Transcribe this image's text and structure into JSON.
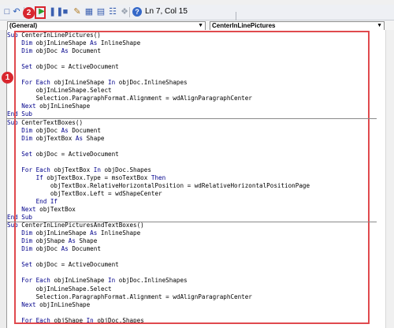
{
  "toolbar": {
    "status": "Ln 7, Col 15",
    "badge_run": "2"
  },
  "combos": {
    "object": "(General)",
    "procedure": "CenterInLinePictures"
  },
  "annotation": {
    "badge_code": "1"
  },
  "code_lines": [
    [
      {
        "t": "Sub ",
        "k": 1
      },
      {
        "t": "CenterInLinePictures()"
      }
    ],
    [
      {
        "t": "    "
      },
      {
        "t": "Dim ",
        "k": 1
      },
      {
        "t": "objInLineShape "
      },
      {
        "t": "As ",
        "k": 1
      },
      {
        "t": "InlineShape"
      }
    ],
    [
      {
        "t": "    "
      },
      {
        "t": "Dim ",
        "k": 1
      },
      {
        "t": "objDoc "
      },
      {
        "t": "As ",
        "k": 1
      },
      {
        "t": "Document"
      }
    ],
    [
      {
        "t": ""
      }
    ],
    [
      {
        "t": "    "
      },
      {
        "t": "Set ",
        "k": 1
      },
      {
        "t": "objDoc = ActiveDocument"
      }
    ],
    [
      {
        "t": ""
      }
    ],
    [
      {
        "t": "    "
      },
      {
        "t": "For Each ",
        "k": 1
      },
      {
        "t": "objInLineShape "
      },
      {
        "t": "In ",
        "k": 1
      },
      {
        "t": "objDoc.InlineShapes"
      }
    ],
    [
      {
        "t": "        objInLineShape.Select"
      }
    ],
    [
      {
        "t": "        Selection.ParagraphFormat.Alignment = wdAlignParagraphCenter"
      }
    ],
    [
      {
        "t": "    "
      },
      {
        "t": "Next ",
        "k": 1
      },
      {
        "t": "objInLineShape"
      }
    ],
    [
      {
        "t": "End Sub",
        "k": 1
      }
    ],
    [
      {
        "t": "Sub ",
        "k": 1
      },
      {
        "t": "CenterTextBoxes()"
      }
    ],
    [
      {
        "t": "    "
      },
      {
        "t": "Dim ",
        "k": 1
      },
      {
        "t": "objDoc "
      },
      {
        "t": "As ",
        "k": 1
      },
      {
        "t": "Document"
      }
    ],
    [
      {
        "t": "    "
      },
      {
        "t": "Dim ",
        "k": 1
      },
      {
        "t": "objTextBox "
      },
      {
        "t": "As ",
        "k": 1
      },
      {
        "t": "Shape"
      }
    ],
    [
      {
        "t": ""
      }
    ],
    [
      {
        "t": "    "
      },
      {
        "t": "Set ",
        "k": 1
      },
      {
        "t": "objDoc = ActiveDocument"
      }
    ],
    [
      {
        "t": ""
      }
    ],
    [
      {
        "t": "    "
      },
      {
        "t": "For Each ",
        "k": 1
      },
      {
        "t": "objTextBox "
      },
      {
        "t": "In ",
        "k": 1
      },
      {
        "t": "objDoc.Shapes"
      }
    ],
    [
      {
        "t": "        "
      },
      {
        "t": "If ",
        "k": 1
      },
      {
        "t": "objTextBox.Type = msoTextBox "
      },
      {
        "t": "Then",
        "k": 1
      }
    ],
    [
      {
        "t": "            objTextBox.RelativeHorizontalPosition = wdRelativeHorizontalPositionPage"
      }
    ],
    [
      {
        "t": "            objTextBox.Left = wdShapeCenter"
      }
    ],
    [
      {
        "t": "        "
      },
      {
        "t": "End If",
        "k": 1
      }
    ],
    [
      {
        "t": "    "
      },
      {
        "t": "Next ",
        "k": 1
      },
      {
        "t": "objTextBox"
      }
    ],
    [
      {
        "t": "End Sub",
        "k": 1
      }
    ],
    [
      {
        "t": "Sub ",
        "k": 1
      },
      {
        "t": "CenterInLinePicturesAndTextBoxes()"
      }
    ],
    [
      {
        "t": "    "
      },
      {
        "t": "Dim ",
        "k": 1
      },
      {
        "t": "objInLineShape "
      },
      {
        "t": "As ",
        "k": 1
      },
      {
        "t": "InlineShape"
      }
    ],
    [
      {
        "t": "    "
      },
      {
        "t": "Dim ",
        "k": 1
      },
      {
        "t": "objShape "
      },
      {
        "t": "As ",
        "k": 1
      },
      {
        "t": "Shape"
      }
    ],
    [
      {
        "t": "    "
      },
      {
        "t": "Dim ",
        "k": 1
      },
      {
        "t": "objDoc "
      },
      {
        "t": "As ",
        "k": 1
      },
      {
        "t": "Document"
      }
    ],
    [
      {
        "t": ""
      }
    ],
    [
      {
        "t": "    "
      },
      {
        "t": "Set ",
        "k": 1
      },
      {
        "t": "objDoc = ActiveDocument"
      }
    ],
    [
      {
        "t": ""
      }
    ],
    [
      {
        "t": "    "
      },
      {
        "t": "For Each ",
        "k": 1
      },
      {
        "t": "objInLineShape "
      },
      {
        "t": "In ",
        "k": 1
      },
      {
        "t": "objDoc.InlineShapes"
      }
    ],
    [
      {
        "t": "        objInLineShape.Select"
      }
    ],
    [
      {
        "t": "        Selection.ParagraphFormat.Alignment = wdAlignParagraphCenter"
      }
    ],
    [
      {
        "t": "    "
      },
      {
        "t": "Next ",
        "k": 1
      },
      {
        "t": "objInLineShape"
      }
    ],
    [
      {
        "t": ""
      }
    ],
    [
      {
        "t": "    "
      },
      {
        "t": "For Each ",
        "k": 1
      },
      {
        "t": "objShape "
      },
      {
        "t": "In ",
        "k": 1
      },
      {
        "t": "objDoc.Shapes"
      }
    ]
  ],
  "procedure_separators_after_line": [
    10,
    23
  ],
  "colors": {
    "keyword": "#00008b",
    "annotation_red": "#e04a4e"
  },
  "icons": [
    "undo-icon",
    "run-icon",
    "pause-icon",
    "stop-icon",
    "design-mode-icon",
    "project-explorer-icon",
    "properties-icon",
    "object-browser-icon",
    "toolbox-icon",
    "help-icon"
  ]
}
